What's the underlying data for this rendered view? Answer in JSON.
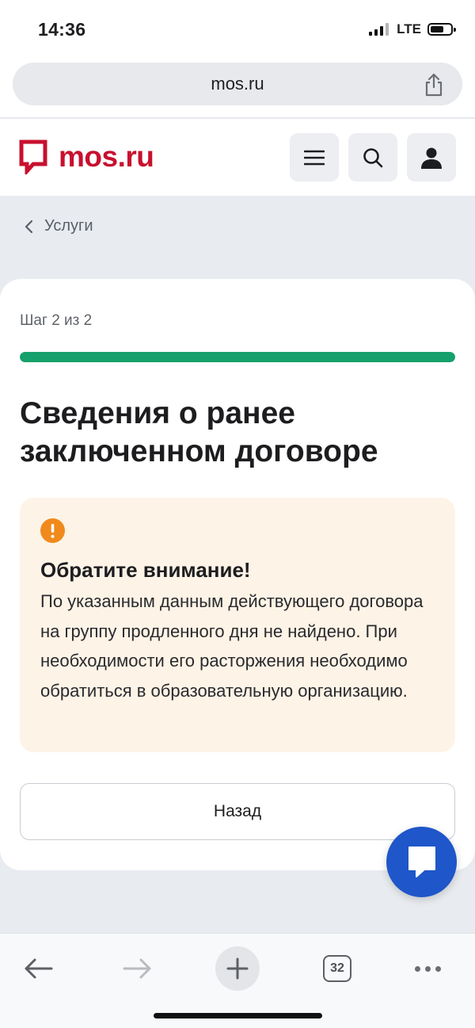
{
  "status_bar": {
    "time": "14:36",
    "network": "LTE"
  },
  "browser": {
    "url": "mos.ru",
    "tabs_count": "32"
  },
  "site": {
    "logo_text": "mos.ru",
    "brand_color": "#c8102e"
  },
  "breadcrumb": {
    "label": "Услуги"
  },
  "form": {
    "step_label": "Шаг 2 из 2",
    "progress_fraction": 1.0,
    "title": "Сведения о ранее заключенном договоре",
    "alert": {
      "title": "Обратите внимание!",
      "text": "По указанным данным действующего договора на группу продленного дня не найдено. При необходимости его расторжения необходимо обратиться в образовательную организацию.",
      "icon": "exclamation-icon"
    },
    "back_button": "Назад"
  },
  "colors": {
    "accent_green": "#16a06b",
    "alert_bg": "#fdf3e6",
    "alert_icon": "#f08a1c",
    "fab_blue": "#1f56c9"
  },
  "icons": [
    "share-icon",
    "menu-icon",
    "search-icon",
    "user-icon",
    "chevron-left-icon",
    "chat-icon",
    "back-arrow-icon",
    "forward-arrow-icon",
    "plus-icon",
    "tabs-icon",
    "more-icon"
  ]
}
